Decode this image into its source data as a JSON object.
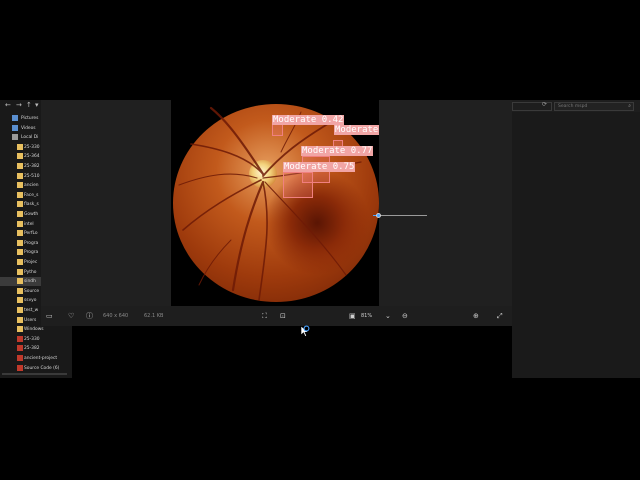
{
  "explorer": {
    "nav": {
      "back": "←",
      "forward": "→",
      "up": "↑",
      "expand": "▾"
    },
    "items": [
      {
        "label": "Pictures",
        "icon": "pictures-icon",
        "kind": "special"
      },
      {
        "label": "Videos",
        "icon": "videos-icon",
        "kind": "special"
      },
      {
        "label": "Local Di",
        "icon": "drive-icon",
        "kind": "drive"
      },
      {
        "label": "25-330",
        "icon": "folder-icon",
        "kind": "folder"
      },
      {
        "label": "25-364",
        "icon": "folder-icon",
        "kind": "folder"
      },
      {
        "label": "25-382",
        "icon": "folder-icon",
        "kind": "folder"
      },
      {
        "label": "25-510",
        "icon": "folder-icon",
        "kind": "folder"
      },
      {
        "label": "ancien",
        "icon": "folder-icon",
        "kind": "folder"
      },
      {
        "label": "Face_s",
        "icon": "folder-icon",
        "kind": "folder"
      },
      {
        "label": "flask_s",
        "icon": "folder-icon",
        "kind": "folder"
      },
      {
        "label": "Gowth",
        "icon": "folder-icon",
        "kind": "folder"
      },
      {
        "label": "intel",
        "icon": "folder-icon",
        "kind": "folder"
      },
      {
        "label": "PerfLo",
        "icon": "folder-icon",
        "kind": "folder"
      },
      {
        "label": "Progra",
        "icon": "folder-icon",
        "kind": "folder"
      },
      {
        "label": "Progra",
        "icon": "folder-icon",
        "kind": "folder"
      },
      {
        "label": "Projec",
        "icon": "folder-icon",
        "kind": "folder"
      },
      {
        "label": "Pytho",
        "icon": "folder-icon",
        "kind": "folder"
      },
      {
        "label": "sindh",
        "icon": "folder-icon",
        "kind": "folder",
        "selected": true
      },
      {
        "label": "Source",
        "icon": "folder-icon",
        "kind": "folder"
      },
      {
        "label": "ssvyo",
        "icon": "folder-icon",
        "kind": "folder"
      },
      {
        "label": "test_w",
        "icon": "folder-icon",
        "kind": "folder"
      },
      {
        "label": "Users",
        "icon": "folder-icon",
        "kind": "folder"
      },
      {
        "label": "Windows",
        "icon": "folder-icon",
        "kind": "folder"
      },
      {
        "label": "25-330",
        "icon": "zip-icon",
        "kind": "zip"
      },
      {
        "label": "25-382",
        "icon": "zip-icon",
        "kind": "zip"
      },
      {
        "label": "ancient-project",
        "icon": "zip-icon",
        "kind": "zip"
      },
      {
        "label": "Source Code (6)",
        "icon": "zip-icon",
        "kind": "zip"
      }
    ]
  },
  "right_pane": {
    "search_placeholder": "Search mspd",
    "refresh": "⟳",
    "search_icon": "⌕"
  },
  "viewer": {
    "detections": [
      {
        "label": "Moderate 0.42"
      },
      {
        "label": "Moderate"
      },
      {
        "label": "Moderate 0.77"
      },
      {
        "label": "Moderate 0.75"
      }
    ],
    "toolbar": {
      "dimensions": "640 x 640",
      "file_size": "62.1 KB",
      "zoom_level": "81%",
      "zoom_fraction": 0.1,
      "icons": {
        "monitor": "▭",
        "favorite": "♡",
        "info": "ⓘ",
        "crop": "⛶",
        "enhance": "⊡",
        "fit": "▣",
        "dropdown": "⌄",
        "zoom_out": "⊖",
        "zoom_in": "⊕",
        "fullscreen": "⤢"
      }
    }
  },
  "colors": {
    "accent": "#4aa3ff",
    "detection": "#f1a5a5",
    "explorer_bg": "#191919",
    "viewer_bg": "#202020"
  }
}
